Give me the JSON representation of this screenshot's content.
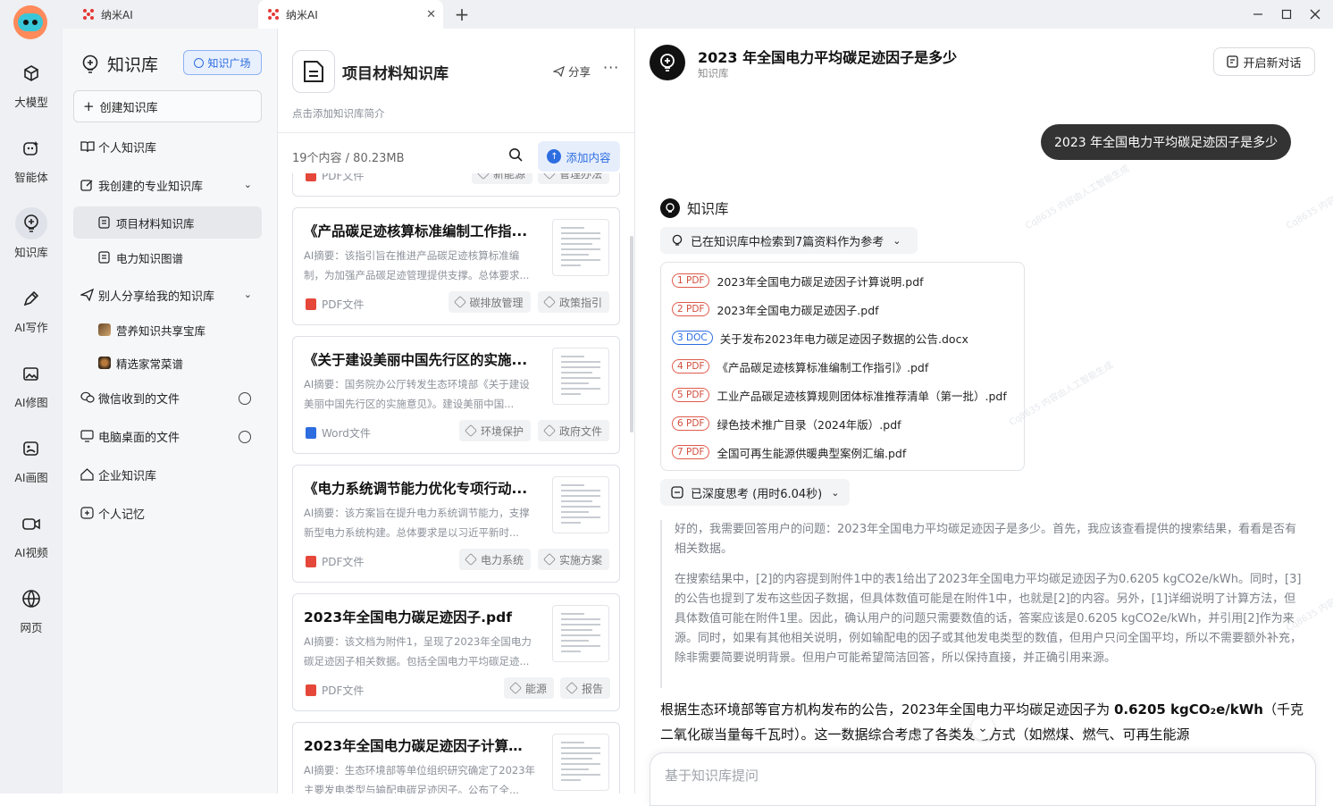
{
  "tabs": [
    {
      "label": "纳米AI",
      "active": false
    },
    {
      "label": "纳米AI",
      "active": true
    }
  ],
  "rail": [
    {
      "label": "大模型",
      "icon": "cube-icon"
    },
    {
      "label": "智能体",
      "icon": "agent-icon"
    },
    {
      "label": "知识库",
      "icon": "bulb-icon",
      "active": true
    },
    {
      "label": "AI写作",
      "icon": "pen-icon"
    },
    {
      "label": "AI修图",
      "icon": "image-edit-icon"
    },
    {
      "label": "AI画图",
      "icon": "paint-icon"
    },
    {
      "label": "AI视频",
      "icon": "video-icon"
    },
    {
      "label": "网页",
      "icon": "globe-icon"
    }
  ],
  "kside": {
    "title": "知识库",
    "plaza": "知识广场",
    "create": "创建知识库",
    "personal": "个人知识库",
    "my_created": "我创建的专业知识库",
    "my_items": [
      "项目材料知识库",
      "电力知识图谱"
    ],
    "shared": "别人分享给我的知识库",
    "shared_items": [
      "营养知识共享宝库",
      "精选家常菜谱"
    ],
    "wechat": "微信收到的文件",
    "desktop": "电脑桌面的文件",
    "enterprise": "企业知识库",
    "memory": "个人记忆"
  },
  "mid": {
    "title": "项目材料知识库",
    "share": "分享",
    "more": "···",
    "desc": "点击添加知识库简介",
    "count": "19个内容 / 80.23MB",
    "add": "添加内容",
    "partial": {
      "type": "PDF文件",
      "tags": [
        "新能源",
        "管理办法"
      ]
    },
    "cards": [
      {
        "title": "《产品碳足迹核算标准编制工作指...",
        "summary": "AI摘要：该指引旨在推进产品碳足迹核算标准编制，为加强产品碳足迹管理提供支撑。总体要求...",
        "type": "PDF文件",
        "tags": [
          "碳排放管理",
          "政策指引"
        ]
      },
      {
        "title": "《关于建设美丽中国先行区的实施...",
        "summary": "AI摘要：国务院办公厅转发生态环境部《关于建设美丽中国先行区的实施意见》。建设美丽中国...",
        "type": "Word文件",
        "tags": [
          "环境保护",
          "政府文件"
        ]
      },
      {
        "title": "《电力系统调节能力优化专项行动...",
        "summary": "AI摘要：该方案旨在提升电力系统调节能力，支撑新型电力系统构建。总体要求是以习近平新时...",
        "type": "PDF文件",
        "tags": [
          "电力系统",
          "实施方案"
        ]
      },
      {
        "title": "2023年全国电力碳足迹因子.pdf",
        "summary": "AI摘要：该文档为附件1，呈现了2023年全国电力碳足迹因子相关数据。包括全国电力平均碳足迹...",
        "type": "PDF文件",
        "tags": [
          "能源",
          "报告"
        ]
      },
      {
        "title": "2023年全国电力碳足迹因子计算说...",
        "summary": "AI摘要：生态环境部等单位组织研究确定了2023年主要发电类型与输配电碳足迹因子。公布了全...",
        "type": "PDF文件",
        "tags": []
      }
    ]
  },
  "chat": {
    "title": "2023 年全国电力平均碳足迹因子是多少",
    "subtitle": "知识库",
    "new_chat": "开启新对话",
    "question": "2023 年全国电力平均碳足迹因子是多少",
    "kb_label": "知识库",
    "retrieved": "已在知识库中检索到7篇资料作为参考",
    "refs": [
      {
        "badge": "1 PDF",
        "kind": "pdf",
        "name": "2023年全国电力碳足迹因子计算说明.pdf"
      },
      {
        "badge": "2 PDF",
        "kind": "pdf",
        "name": "2023年全国电力碳足迹因子.pdf"
      },
      {
        "badge": "3 DOC",
        "kind": "doc",
        "name": "关于发布2023年电力碳足迹因子数据的公告.docx"
      },
      {
        "badge": "4 PDF",
        "kind": "pdf",
        "name": "《产品碳足迹核算标准编制工作指引》.pdf"
      },
      {
        "badge": "5 PDF",
        "kind": "pdf",
        "name": "工业产品碳足迹核算规则团体标准推荐清单（第一批）.pdf"
      },
      {
        "badge": "6 PDF",
        "kind": "pdf",
        "name": "绿色技术推广目录（2024年版）.pdf"
      },
      {
        "badge": "7 PDF",
        "kind": "pdf",
        "name": "全国可再生能源供暖典型案例汇编.pdf"
      }
    ],
    "thinking_label": "已深度思考 (用时6.04秒)",
    "thinking": [
      "好的，我需要回答用户的问题：2023年全国电力平均碳足迹因子是多少。首先，我应该查看提供的搜索结果，看看是否有相关数据。",
      "在搜索结果中，[2]的内容提到附件1中的表1给出了2023年全国电力平均碳足迹因子为0.6205 kgCO2e/kWh。同时，[3]的公告也提到了发布这些因子数据，但具体数值可能是在附件1中，也就是[2]的内容。另外，[1]详细说明了计算方法，但具体数值可能在附件1里。因此，确认用户的问题只需要数值的话，答案应该是0.6205 kgCO2e/kWh，并引用[2]作为来源。同时，如果有其他相关说明，例如输配电的因子或其他发电类型的数值，但用户只问全国平均，所以不需要额外补充，除非需要简要说明背景。但用户可能希望简洁回答，所以保持直接，并正确引用来源。"
    ],
    "answer_pre": "根据生态环境部等官方机构发布的公告，2023年全国电力平均碳足迹因子为 ",
    "answer_value": "0.6205 kgCO₂e/kWh",
    "answer_post": "（千克二氧化碳当量每千瓦时）。这一数据综合考虑了各类发电方式（如燃煤、燃气、可再生能源",
    "input_placeholder": "基于知识库提问"
  }
}
